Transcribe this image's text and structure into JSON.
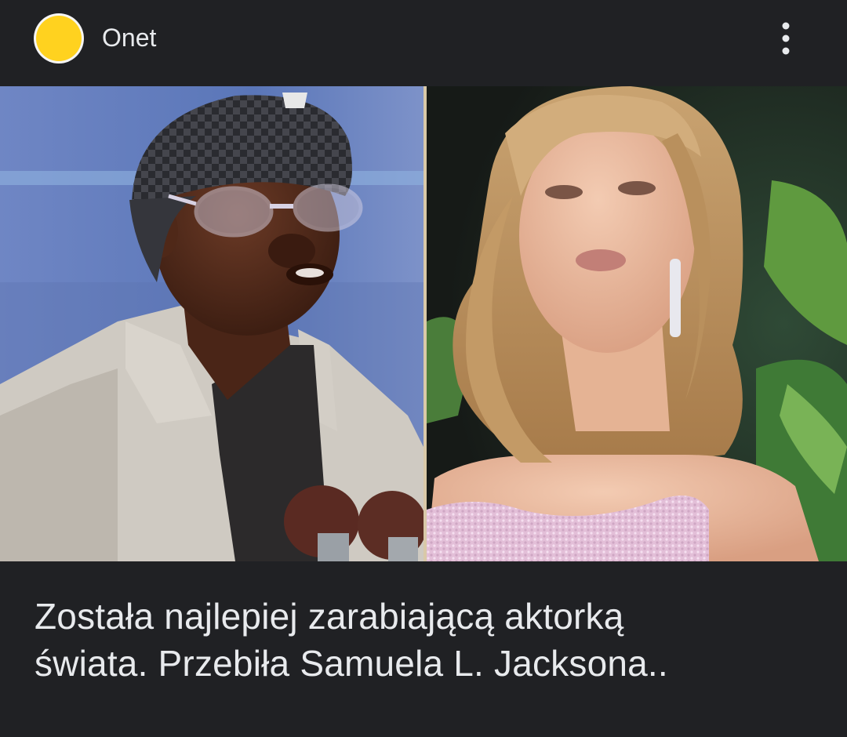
{
  "source": {
    "name": "Onet",
    "logo_color": "#ffd21f"
  },
  "header": {
    "menu_icon": "more-vert-icon"
  },
  "image": {
    "left_photo_icon": "photo-icon",
    "right_photo_icon": "photo-icon"
  },
  "headline": {
    "line1": "Została najlepiej zarabiającą aktorką",
    "line2": "świata. Przebiła Samuela L. Jacksona.."
  },
  "colors": {
    "background": "#202124",
    "text": "#e8eaed",
    "accent": "#ffd21f"
  }
}
